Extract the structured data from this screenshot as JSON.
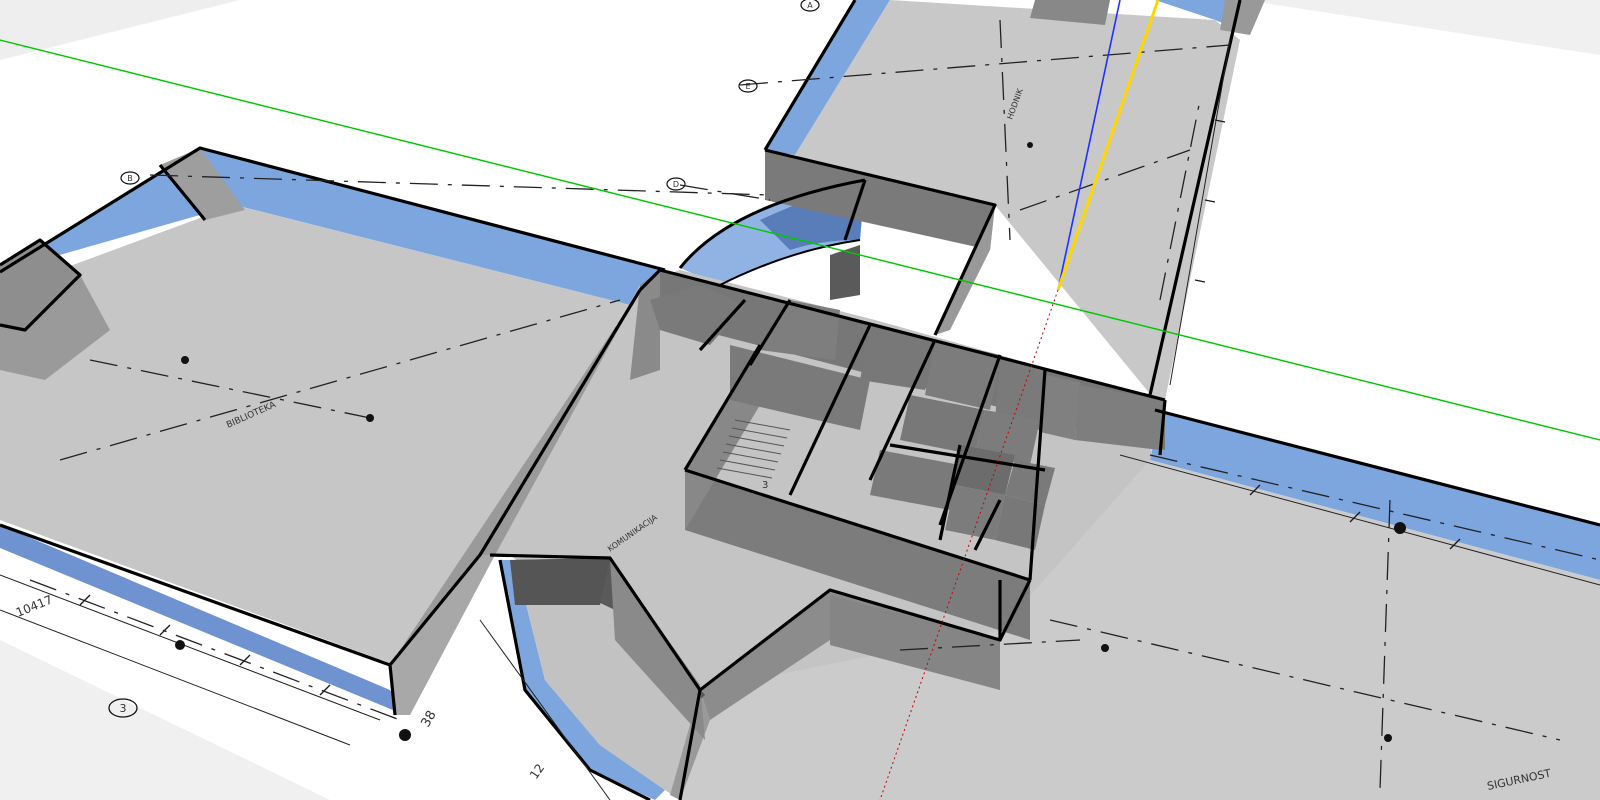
{
  "app": {
    "title": ""
  },
  "viewport": {
    "background": "#ffffff",
    "ground_plane_color": "#f0f0f0",
    "axes": {
      "x_color": "#00c800",
      "z_color": "#1e32ff",
      "y_color": "#ffd700"
    },
    "colors": {
      "wall_side": "#777777",
      "wall_top": "#aaaaaa",
      "floor": "#c8c8c8",
      "glazing": "#7ea6de",
      "glazing_dark": "#5a80c0",
      "edge": "#000000"
    }
  },
  "grid_bubbles": [
    {
      "label": "3"
    },
    {
      "label": "B"
    },
    {
      "label": "D"
    },
    {
      "label": "E"
    },
    {
      "label": "A"
    }
  ],
  "plan_labels": {
    "dimension_left": "10417",
    "dimension_bottom": "38",
    "dimension_curve": "12",
    "section_tag": "3",
    "room_left": "BIBLIOTEKA",
    "room_mid": "KOMUNIKACIJA",
    "room_top": "HODNIK",
    "title_block": "SIGURNOST"
  }
}
